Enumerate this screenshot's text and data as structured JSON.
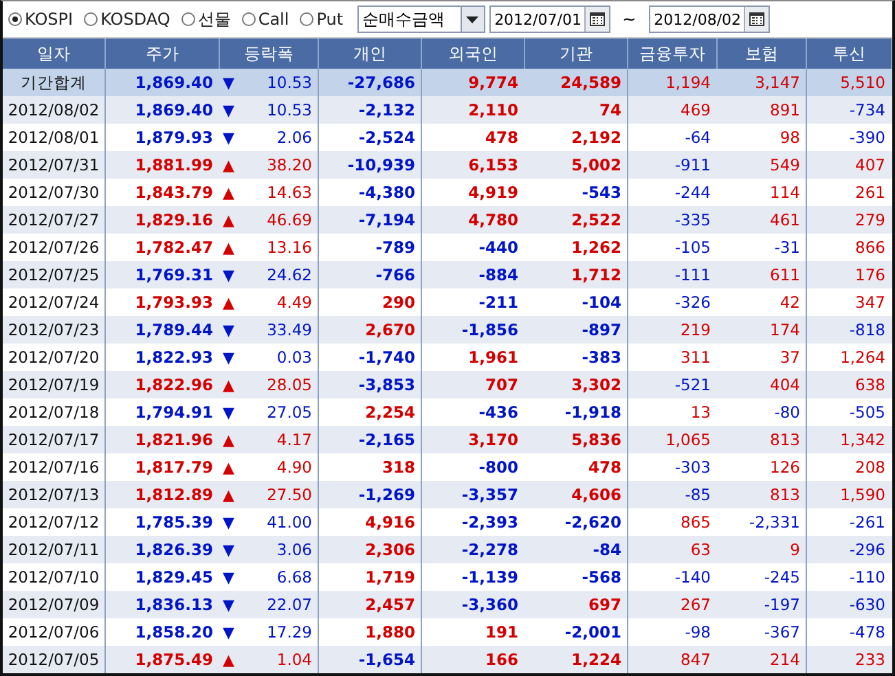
{
  "toolbar": {
    "markets": [
      {
        "label": "KOSPI",
        "selected": true
      },
      {
        "label": "KOSDAQ",
        "selected": false
      },
      {
        "label": "선물",
        "selected": false
      },
      {
        "label": "Call",
        "selected": false
      },
      {
        "label": "Put",
        "selected": false
      }
    ],
    "measure": "순매수금액",
    "date_from": "2012/07/01",
    "separator": "~",
    "date_to": "2012/08/02"
  },
  "table": {
    "columns": [
      "일자",
      "주가",
      "등락폭",
      "개인",
      "외국인",
      "기관",
      "금융투자",
      "보험",
      "투신"
    ],
    "rows": [
      {
        "kind": "total",
        "date": "기간합계",
        "price": "1,869.40",
        "rising": false,
        "arrow": "▼",
        "change": "10.53",
        "values": [
          {
            "text": "-27,686",
            "negative": true
          },
          {
            "text": "9,774",
            "negative": false
          },
          {
            "text": "24,589",
            "negative": false
          },
          {
            "text": "1,194",
            "negative": false
          },
          {
            "text": "3,147",
            "negative": false
          },
          {
            "text": "5,510",
            "negative": false
          }
        ]
      },
      {
        "kind": "day",
        "date": "2012/08/02",
        "price": "1,869.40",
        "rising": false,
        "arrow": "▼",
        "change": "10.53",
        "values": [
          {
            "text": "-2,132",
            "negative": true
          },
          {
            "text": "2,110",
            "negative": false
          },
          {
            "text": "74",
            "negative": false
          },
          {
            "text": "469",
            "negative": false
          },
          {
            "text": "891",
            "negative": false
          },
          {
            "text": "-734",
            "negative": true
          }
        ]
      },
      {
        "kind": "day",
        "date": "2012/08/01",
        "price": "1,879.93",
        "rising": false,
        "arrow": "▼",
        "change": "2.06",
        "values": [
          {
            "text": "-2,524",
            "negative": true
          },
          {
            "text": "478",
            "negative": false
          },
          {
            "text": "2,192",
            "negative": false
          },
          {
            "text": "-64",
            "negative": true
          },
          {
            "text": "98",
            "negative": false
          },
          {
            "text": "-390",
            "negative": true
          }
        ]
      },
      {
        "kind": "day",
        "date": "2012/07/31",
        "price": "1,881.99",
        "rising": true,
        "arrow": "▲",
        "change": "38.20",
        "values": [
          {
            "text": "-10,939",
            "negative": true
          },
          {
            "text": "6,153",
            "negative": false
          },
          {
            "text": "5,002",
            "negative": false
          },
          {
            "text": "-911",
            "negative": true
          },
          {
            "text": "549",
            "negative": false
          },
          {
            "text": "407",
            "negative": false
          }
        ]
      },
      {
        "kind": "day",
        "date": "2012/07/30",
        "price": "1,843.79",
        "rising": true,
        "arrow": "▲",
        "change": "14.63",
        "values": [
          {
            "text": "-4,380",
            "negative": true
          },
          {
            "text": "4,919",
            "negative": false
          },
          {
            "text": "-543",
            "negative": true
          },
          {
            "text": "-244",
            "negative": true
          },
          {
            "text": "114",
            "negative": false
          },
          {
            "text": "261",
            "negative": false
          }
        ]
      },
      {
        "kind": "day",
        "date": "2012/07/27",
        "price": "1,829.16",
        "rising": true,
        "arrow": "▲",
        "change": "46.69",
        "values": [
          {
            "text": "-7,194",
            "negative": true
          },
          {
            "text": "4,780",
            "negative": false
          },
          {
            "text": "2,522",
            "negative": false
          },
          {
            "text": "-335",
            "negative": true
          },
          {
            "text": "461",
            "negative": false
          },
          {
            "text": "279",
            "negative": false
          }
        ]
      },
      {
        "kind": "day",
        "date": "2012/07/26",
        "price": "1,782.47",
        "rising": true,
        "arrow": "▲",
        "change": "13.16",
        "values": [
          {
            "text": "-789",
            "negative": true
          },
          {
            "text": "-440",
            "negative": true
          },
          {
            "text": "1,262",
            "negative": false
          },
          {
            "text": "-105",
            "negative": true
          },
          {
            "text": "-31",
            "negative": true
          },
          {
            "text": "866",
            "negative": false
          }
        ]
      },
      {
        "kind": "day",
        "date": "2012/07/25",
        "price": "1,769.31",
        "rising": false,
        "arrow": "▼",
        "change": "24.62",
        "values": [
          {
            "text": "-766",
            "negative": true
          },
          {
            "text": "-884",
            "negative": true
          },
          {
            "text": "1,712",
            "negative": false
          },
          {
            "text": "-111",
            "negative": true
          },
          {
            "text": "611",
            "negative": false
          },
          {
            "text": "176",
            "negative": false
          }
        ]
      },
      {
        "kind": "day",
        "date": "2012/07/24",
        "price": "1,793.93",
        "rising": true,
        "arrow": "▲",
        "change": "4.49",
        "values": [
          {
            "text": "290",
            "negative": false
          },
          {
            "text": "-211",
            "negative": true
          },
          {
            "text": "-104",
            "negative": true
          },
          {
            "text": "-326",
            "negative": true
          },
          {
            "text": "42",
            "negative": false
          },
          {
            "text": "347",
            "negative": false
          }
        ]
      },
      {
        "kind": "day",
        "date": "2012/07/23",
        "price": "1,789.44",
        "rising": false,
        "arrow": "▼",
        "change": "33.49",
        "values": [
          {
            "text": "2,670",
            "negative": false
          },
          {
            "text": "-1,856",
            "negative": true
          },
          {
            "text": "-897",
            "negative": true
          },
          {
            "text": "219",
            "negative": false
          },
          {
            "text": "174",
            "negative": false
          },
          {
            "text": "-818",
            "negative": true
          }
        ]
      },
      {
        "kind": "day",
        "date": "2012/07/20",
        "price": "1,822.93",
        "rising": false,
        "arrow": "▼",
        "change": "0.03",
        "values": [
          {
            "text": "-1,740",
            "negative": true
          },
          {
            "text": "1,961",
            "negative": false
          },
          {
            "text": "-383",
            "negative": true
          },
          {
            "text": "311",
            "negative": false
          },
          {
            "text": "37",
            "negative": false
          },
          {
            "text": "1,264",
            "negative": false
          }
        ]
      },
      {
        "kind": "day",
        "date": "2012/07/19",
        "price": "1,822.96",
        "rising": true,
        "arrow": "▲",
        "change": "28.05",
        "values": [
          {
            "text": "-3,853",
            "negative": true
          },
          {
            "text": "707",
            "negative": false
          },
          {
            "text": "3,302",
            "negative": false
          },
          {
            "text": "-521",
            "negative": true
          },
          {
            "text": "404",
            "negative": false
          },
          {
            "text": "638",
            "negative": false
          }
        ]
      },
      {
        "kind": "day",
        "date": "2012/07/18",
        "price": "1,794.91",
        "rising": false,
        "arrow": "▼",
        "change": "27.05",
        "values": [
          {
            "text": "2,254",
            "negative": false
          },
          {
            "text": "-436",
            "negative": true
          },
          {
            "text": "-1,918",
            "negative": true
          },
          {
            "text": "13",
            "negative": false
          },
          {
            "text": "-80",
            "negative": true
          },
          {
            "text": "-505",
            "negative": true
          }
        ]
      },
      {
        "kind": "day",
        "date": "2012/07/17",
        "price": "1,821.96",
        "rising": true,
        "arrow": "▲",
        "change": "4.17",
        "values": [
          {
            "text": "-2,165",
            "negative": true
          },
          {
            "text": "3,170",
            "negative": false
          },
          {
            "text": "5,836",
            "negative": false
          },
          {
            "text": "1,065",
            "negative": false
          },
          {
            "text": "813",
            "negative": false
          },
          {
            "text": "1,342",
            "negative": false
          }
        ]
      },
      {
        "kind": "day",
        "date": "2012/07/16",
        "price": "1,817.79",
        "rising": true,
        "arrow": "▲",
        "change": "4.90",
        "values": [
          {
            "text": "318",
            "negative": false
          },
          {
            "text": "-800",
            "negative": true
          },
          {
            "text": "478",
            "negative": false
          },
          {
            "text": "-303",
            "negative": true
          },
          {
            "text": "126",
            "negative": false
          },
          {
            "text": "208",
            "negative": false
          }
        ]
      },
      {
        "kind": "day",
        "date": "2012/07/13",
        "price": "1,812.89",
        "rising": true,
        "arrow": "▲",
        "change": "27.50",
        "values": [
          {
            "text": "-1,269",
            "negative": true
          },
          {
            "text": "-3,357",
            "negative": true
          },
          {
            "text": "4,606",
            "negative": false
          },
          {
            "text": "-85",
            "negative": true
          },
          {
            "text": "813",
            "negative": false
          },
          {
            "text": "1,590",
            "negative": false
          }
        ]
      },
      {
        "kind": "day",
        "date": "2012/07/12",
        "price": "1,785.39",
        "rising": false,
        "arrow": "▼",
        "change": "41.00",
        "values": [
          {
            "text": "4,916",
            "negative": false
          },
          {
            "text": "-2,393",
            "negative": true
          },
          {
            "text": "-2,620",
            "negative": true
          },
          {
            "text": "865",
            "negative": false
          },
          {
            "text": "-2,331",
            "negative": true
          },
          {
            "text": "-261",
            "negative": true
          }
        ]
      },
      {
        "kind": "day",
        "date": "2012/07/11",
        "price": "1,826.39",
        "rising": false,
        "arrow": "▼",
        "change": "3.06",
        "values": [
          {
            "text": "2,306",
            "negative": false
          },
          {
            "text": "-2,278",
            "negative": true
          },
          {
            "text": "-84",
            "negative": true
          },
          {
            "text": "63",
            "negative": false
          },
          {
            "text": "9",
            "negative": false
          },
          {
            "text": "-296",
            "negative": true
          }
        ]
      },
      {
        "kind": "day",
        "date": "2012/07/10",
        "price": "1,829.45",
        "rising": false,
        "arrow": "▼",
        "change": "6.68",
        "values": [
          {
            "text": "1,719",
            "negative": false
          },
          {
            "text": "-1,139",
            "negative": true
          },
          {
            "text": "-568",
            "negative": true
          },
          {
            "text": "-140",
            "negative": true
          },
          {
            "text": "-245",
            "negative": true
          },
          {
            "text": "-110",
            "negative": true
          }
        ]
      },
      {
        "kind": "day",
        "date": "2012/07/09",
        "price": "1,836.13",
        "rising": false,
        "arrow": "▼",
        "change": "22.07",
        "values": [
          {
            "text": "2,457",
            "negative": false
          },
          {
            "text": "-3,360",
            "negative": true
          },
          {
            "text": "697",
            "negative": false
          },
          {
            "text": "267",
            "negative": false
          },
          {
            "text": "-197",
            "negative": true
          },
          {
            "text": "-630",
            "negative": true
          }
        ]
      },
      {
        "kind": "day",
        "date": "2012/07/06",
        "price": "1,858.20",
        "rising": false,
        "arrow": "▼",
        "change": "17.29",
        "values": [
          {
            "text": "1,880",
            "negative": false
          },
          {
            "text": "191",
            "negative": false
          },
          {
            "text": "-2,001",
            "negative": true
          },
          {
            "text": "-98",
            "negative": true
          },
          {
            "text": "-367",
            "negative": true
          },
          {
            "text": "-478",
            "negative": true
          }
        ]
      },
      {
        "kind": "day",
        "date": "2012/07/05",
        "price": "1,875.49",
        "rising": true,
        "arrow": "▲",
        "change": "1.04",
        "values": [
          {
            "text": "-1,654",
            "negative": true
          },
          {
            "text": "166",
            "negative": false
          },
          {
            "text": "1,224",
            "negative": false
          },
          {
            "text": "847",
            "negative": false
          },
          {
            "text": "214",
            "negative": false
          },
          {
            "text": "233",
            "negative": false
          }
        ]
      }
    ]
  }
}
